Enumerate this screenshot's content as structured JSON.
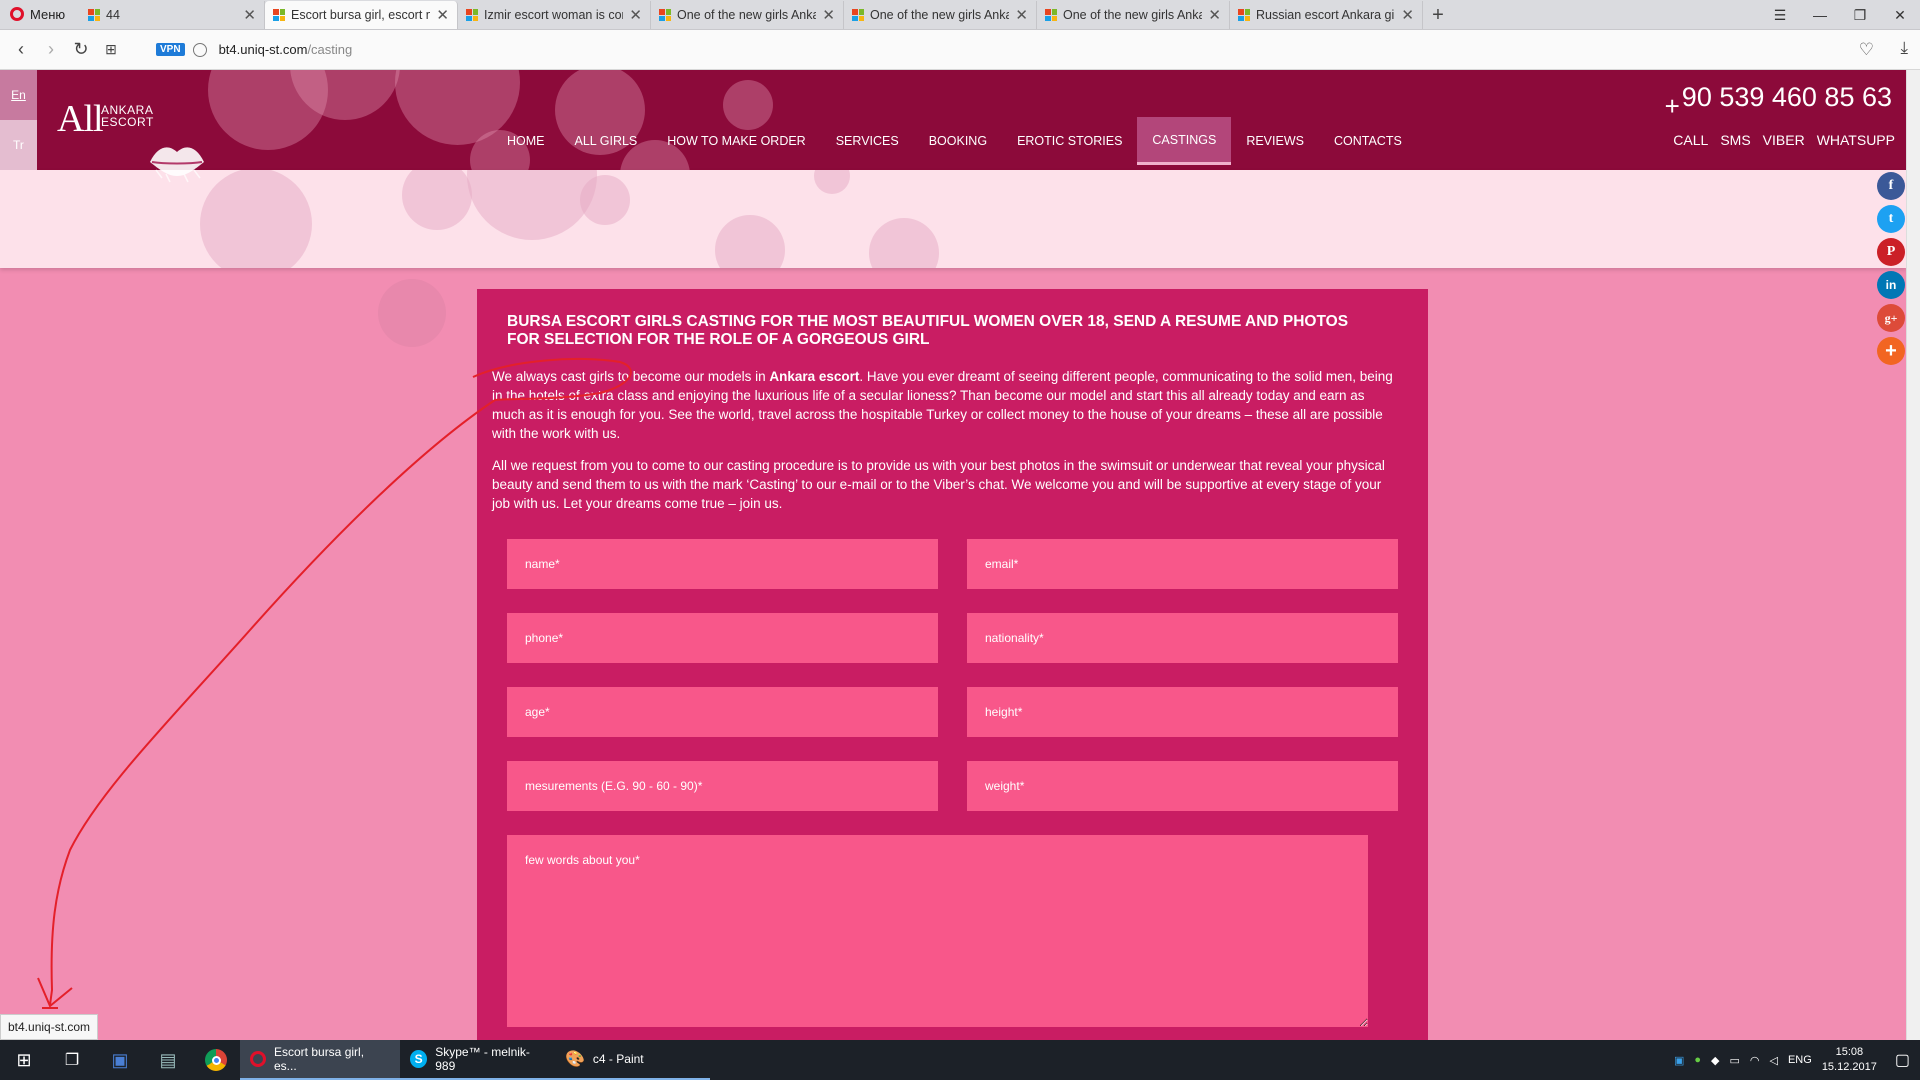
{
  "browser": {
    "menu_label": "Меню",
    "tabs": [
      {
        "title": "44"
      },
      {
        "title": "Escort bursa girl, escort m"
      },
      {
        "title": "Izmir escort woman is com"
      },
      {
        "title": "One of the new girls Ankar"
      },
      {
        "title": "One of the new girls Ankar"
      },
      {
        "title": "One of the new girls Anka"
      },
      {
        "title": "Russian escort Ankara girl"
      }
    ],
    "vpn_label": "VPN",
    "url_host": "bt4.uniq-st.com",
    "url_path": "/casting",
    "status_url": "bt4.uniq-st.com"
  },
  "site": {
    "langs": [
      "En",
      "Tr"
    ],
    "logo_all": "All",
    "logo_line1": "ANKARA",
    "logo_line2": "ESCORT",
    "nav": [
      "HOME",
      "ALL GIRLS",
      "HOW TO MAKE ORDER",
      "SERVICES",
      "BOOKING",
      "EROTIC STORIES",
      "CASTINGS",
      "REVIEWS",
      "CONTACTS"
    ],
    "active_nav": "CASTINGS",
    "phone_plus": "+",
    "phone": "90 539 460 85 63",
    "contact_links": [
      "CALL",
      "SMS",
      "VIBER",
      "WHATSUPP"
    ],
    "share": [
      {
        "icon": "facebook-icon",
        "glyph": "f",
        "color": "#3b5998"
      },
      {
        "icon": "twitter-icon",
        "glyph": "t",
        "color": "#1da1f2"
      },
      {
        "icon": "pinterest-icon",
        "glyph": "P",
        "color": "#cb2027"
      },
      {
        "icon": "linkedin-icon",
        "glyph": "in",
        "color": "#0077b5"
      },
      {
        "icon": "google-plus-icon",
        "glyph": "g+",
        "color": "#dd4b39"
      },
      {
        "icon": "more-share-icon",
        "glyph": "+",
        "color": "#f26522"
      }
    ]
  },
  "content": {
    "heading": "BURSA ESCORT GIRLS CASTING FOR THE MOST BEAUTIFUL WOMEN OVER 18, SEND A RESUME AND PHOTOS FOR SELECTION FOR THE ROLE OF A GORGEOUS GIRL",
    "para1_before": "We always cast girls to become our models in ",
    "para1_bold": "Ankara escort",
    "para1_after": ". Have you ever dreamt of seeing different people, communicating to the solid men, being in the hotels of extra class and enjoying the luxurious life of a secular lioness? Than become our model and start this all already today and earn as much as it is enough for you. See the world, travel across the hospitable Turkey or collect money to the house of your dreams – these all are possible with the work with us.",
    "para2": "All we request from you to come to our casting procedure is to provide us with your best photos in the swimsuit or underwear that reveal your physical beauty and send them to us with the mark ‘Casting’ to our e-mail or to the Viber’s chat. We welcome you and will be supportive at every stage of your job with us. Let your dreams come true – join us."
  },
  "form": {
    "name": "name*",
    "email": "email*",
    "phone": "phone*",
    "nationality": "nationality*",
    "age": "age*",
    "height": "height*",
    "measurements": "mesurements (E.G. 90 - 60 - 90)*",
    "weight": "weight*",
    "about": "few words about you*"
  },
  "taskbar": {
    "apps": [
      {
        "label": "Escort bursa girl, es..."
      },
      {
        "label": "Skype™ - melnik-989"
      },
      {
        "label": "c4 - Paint"
      }
    ],
    "lang": "ENG",
    "time": "15:08",
    "date": "15.12.2017"
  }
}
